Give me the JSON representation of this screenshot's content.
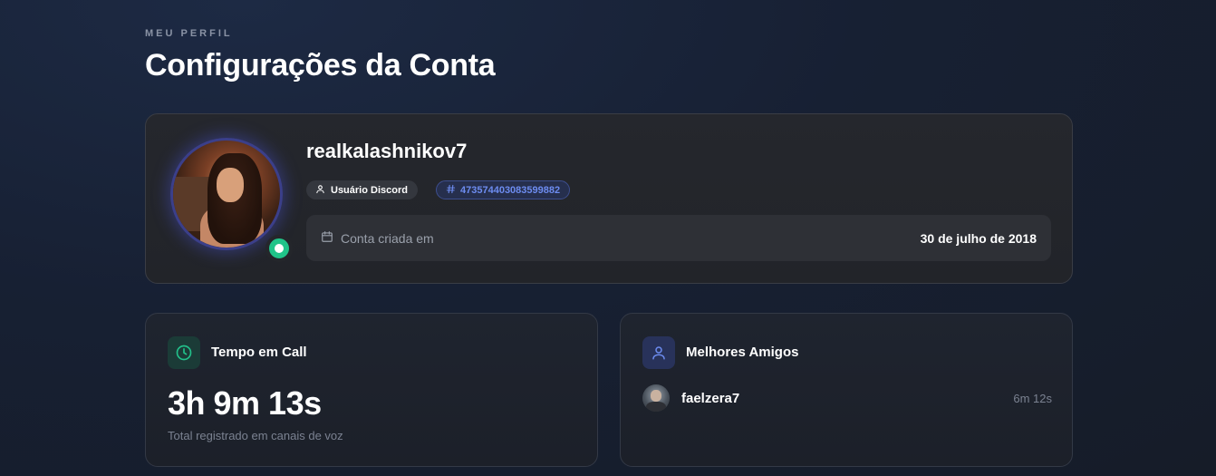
{
  "header": {
    "eyebrow": "MEU PERFIL",
    "title": "Configurações da Conta"
  },
  "profile": {
    "username": "realkalashnikov7",
    "badge_user": "Usuário Discord",
    "badge_id": "473574403083599882",
    "status": "online",
    "status_color": "#20c489",
    "created_label": "Conta criada em",
    "created_date": "30 de julho de 2018"
  },
  "call_time": {
    "title": "Tempo em Call",
    "value": "3h 9m 13s",
    "subtitle": "Total registrado em canais de voz",
    "icon": "clock-icon"
  },
  "best_friends": {
    "title": "Melhores Amigos",
    "icon": "user-icon",
    "items": [
      {
        "name": "faelzera7",
        "time": "6m 12s"
      }
    ]
  }
}
